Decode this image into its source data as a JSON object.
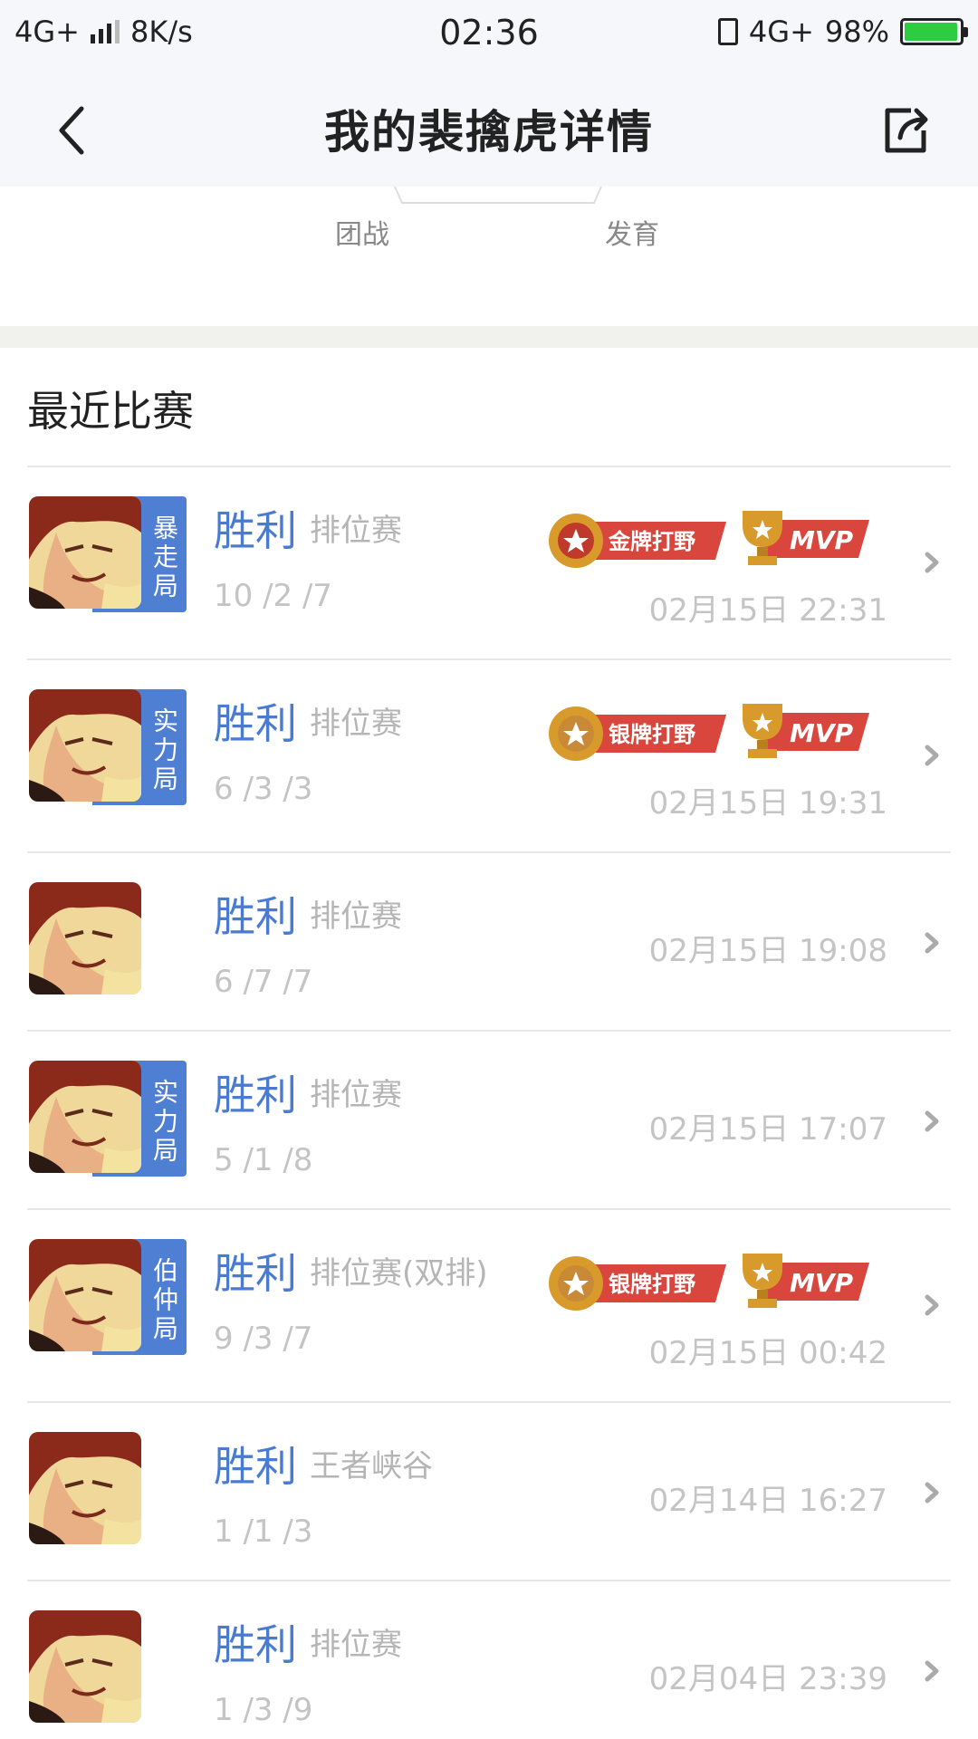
{
  "status_bar": {
    "network": "4G+",
    "speed": "8K/s",
    "time": "02:36",
    "network_right": "4G+",
    "battery": "98%",
    "battery_color": "#2ecc40"
  },
  "nav": {
    "title": "我的裴擒虎详情",
    "back_icon": "chevron-left-icon",
    "share_icon": "share-icon"
  },
  "radar": {
    "label_left": "团战",
    "label_right": "发育"
  },
  "section": {
    "title": "最近比赛"
  },
  "colors": {
    "accent": "#4a7bd1",
    "tag": "#4f7fd2",
    "badge_red": "#d9463d",
    "badge_gold": "#d89a2b"
  },
  "matches": [
    {
      "result": "胜利",
      "mode": "排位赛",
      "kda": "10 /2 /7",
      "date": "02月15日 22:31",
      "tag": "暴走局",
      "badge": "金牌打野",
      "mvp": "MVP"
    },
    {
      "result": "胜利",
      "mode": "排位赛",
      "kda": "6 /3 /3",
      "date": "02月15日 19:31",
      "tag": "实力局",
      "badge": "银牌打野",
      "mvp": "MVP"
    },
    {
      "result": "胜利",
      "mode": "排位赛",
      "kda": "6 /7 /7",
      "date": "02月15日 19:08",
      "tag": "",
      "badge": "",
      "mvp": ""
    },
    {
      "result": "胜利",
      "mode": "排位赛",
      "kda": "5 /1 /8",
      "date": "02月15日 17:07",
      "tag": "实力局",
      "badge": "",
      "mvp": ""
    },
    {
      "result": "胜利",
      "mode": "排位赛(双排)",
      "kda": "9 /3 /7",
      "date": "02月15日 00:42",
      "tag": "伯仲局",
      "badge": "银牌打野",
      "mvp": "MVP"
    },
    {
      "result": "胜利",
      "mode": "王者峡谷",
      "kda": "1 /1 /3",
      "date": "02月14日 16:27",
      "tag": "",
      "badge": "",
      "mvp": ""
    },
    {
      "result": "胜利",
      "mode": "排位赛",
      "kda": "1 /3 /9",
      "date": "02月04日 23:39",
      "tag": "",
      "badge": "",
      "mvp": ""
    }
  ]
}
